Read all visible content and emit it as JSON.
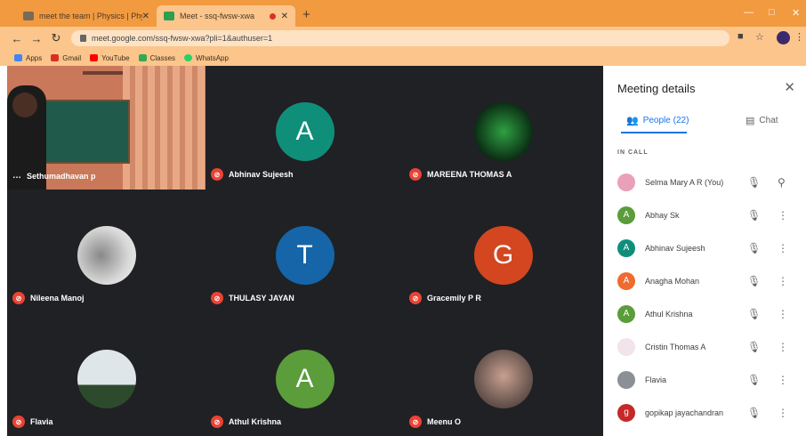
{
  "browser": {
    "tabs": [
      {
        "title": "meet the team | Physics | Physic"
      },
      {
        "title": "Meet - ssq-fwsw-xwa"
      }
    ],
    "url": "meet.google.com/ssq-fwsw-xwa?pli=1&authuser=1",
    "bookmarks": [
      "Apps",
      "Gmail",
      "YouTube",
      "Classes",
      "WhatsApp"
    ]
  },
  "grid": {
    "tiles": [
      {
        "name": "Sethumadhavan p",
        "kind": "video"
      },
      {
        "name": "Abhinav Sujeesh",
        "initial": "A",
        "color": "#0f8f7a"
      },
      {
        "name": "MAREENA THOMAS A",
        "kind": "photo",
        "color": "#0b2e14"
      },
      {
        "name": "Nileena Manoj",
        "kind": "photo",
        "color": "#d8d8d8"
      },
      {
        "name": "THULASY JAYAN",
        "initial": "T",
        "color": "#1565a8"
      },
      {
        "name": "Gracemily P R",
        "initial": "G",
        "color": "#d3461f"
      },
      {
        "name": "Flavia",
        "kind": "photo",
        "color": "#b9c4c9"
      },
      {
        "name": "Athul Krishna",
        "initial": "A",
        "color": "#5a9d3a"
      },
      {
        "name": "Meenu O",
        "kind": "photo",
        "color": "#6e5a52"
      }
    ]
  },
  "panel": {
    "title": "Meeting details",
    "people_tab": "People (22)",
    "chat_tab": "Chat",
    "section": "IN CALL",
    "participants": [
      {
        "name": "Selma Mary A R (You)",
        "initial": "",
        "color": "#e9a0b8"
      },
      {
        "name": "Abhay Sk",
        "initial": "A",
        "color": "#5a9d3a"
      },
      {
        "name": "Abhinav Sujeesh",
        "initial": "A",
        "color": "#0f8f7a"
      },
      {
        "name": "Anagha Mohan",
        "initial": "A",
        "color": "#f06b2f"
      },
      {
        "name": "Athul Krishna",
        "initial": "A",
        "color": "#5a9d3a"
      },
      {
        "name": "Cristin Thomas A",
        "initial": "",
        "color": "#f1e4ea"
      },
      {
        "name": "Flavia",
        "initial": "",
        "color": "#8a9095"
      },
      {
        "name": "gopikap jayachandran",
        "initial": "g",
        "color": "#c62828"
      }
    ]
  }
}
